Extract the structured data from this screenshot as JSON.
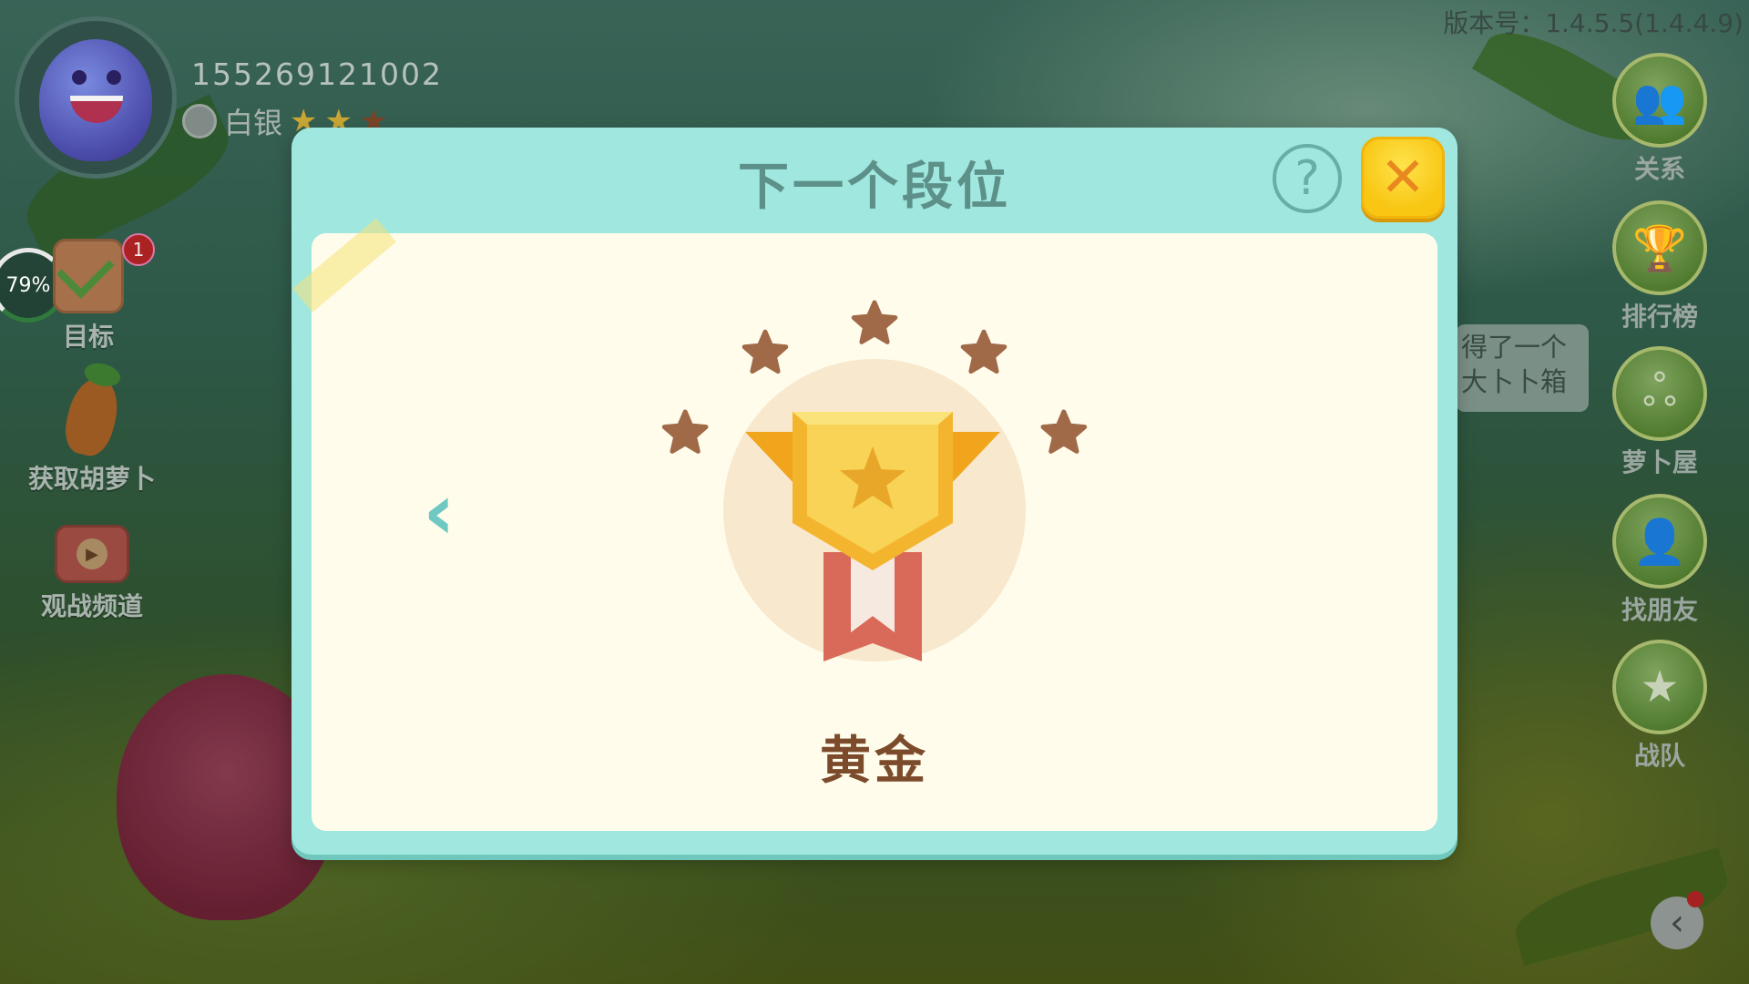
{
  "version": "版本号：1.4.5.5(1.4.4.9)",
  "profile": {
    "user_id": "155269121002",
    "rank_name": "白银",
    "rank_stars_filled": 2,
    "rank_stars_total": 3
  },
  "left_menu": {
    "progress": "79%",
    "goal": {
      "label": "目标",
      "badge": "1"
    },
    "carrot": {
      "label": "获取胡萝卜"
    },
    "spectate": {
      "label": "观战频道"
    }
  },
  "right_menu": [
    {
      "label": "关系",
      "icon": "people-icon"
    },
    {
      "label": "排行榜",
      "icon": "trophy-icon"
    },
    {
      "label": "萝卜屋",
      "icon": "swirl-icon"
    },
    {
      "label": "找朋友",
      "icon": "add-friend-icon"
    },
    {
      "label": "战队",
      "icon": "team-star-icon"
    }
  ],
  "bubble": {
    "line1": "得了一个",
    "line2": "大卜卜箱"
  },
  "modal": {
    "title": "下一个段位",
    "help_label": "?",
    "close_label": "✕",
    "prev_label": "‹",
    "rank_name": "黄金",
    "stars": 5
  },
  "colors": {
    "modal_bg": "#9fe7df",
    "card_bg": "#fffcec",
    "title": "#5d9088",
    "close_button": "#f8c613",
    "rank_text": "#7b4b2c",
    "star_brown": "#a06a48",
    "medal_gold": "#f3bf3a"
  }
}
